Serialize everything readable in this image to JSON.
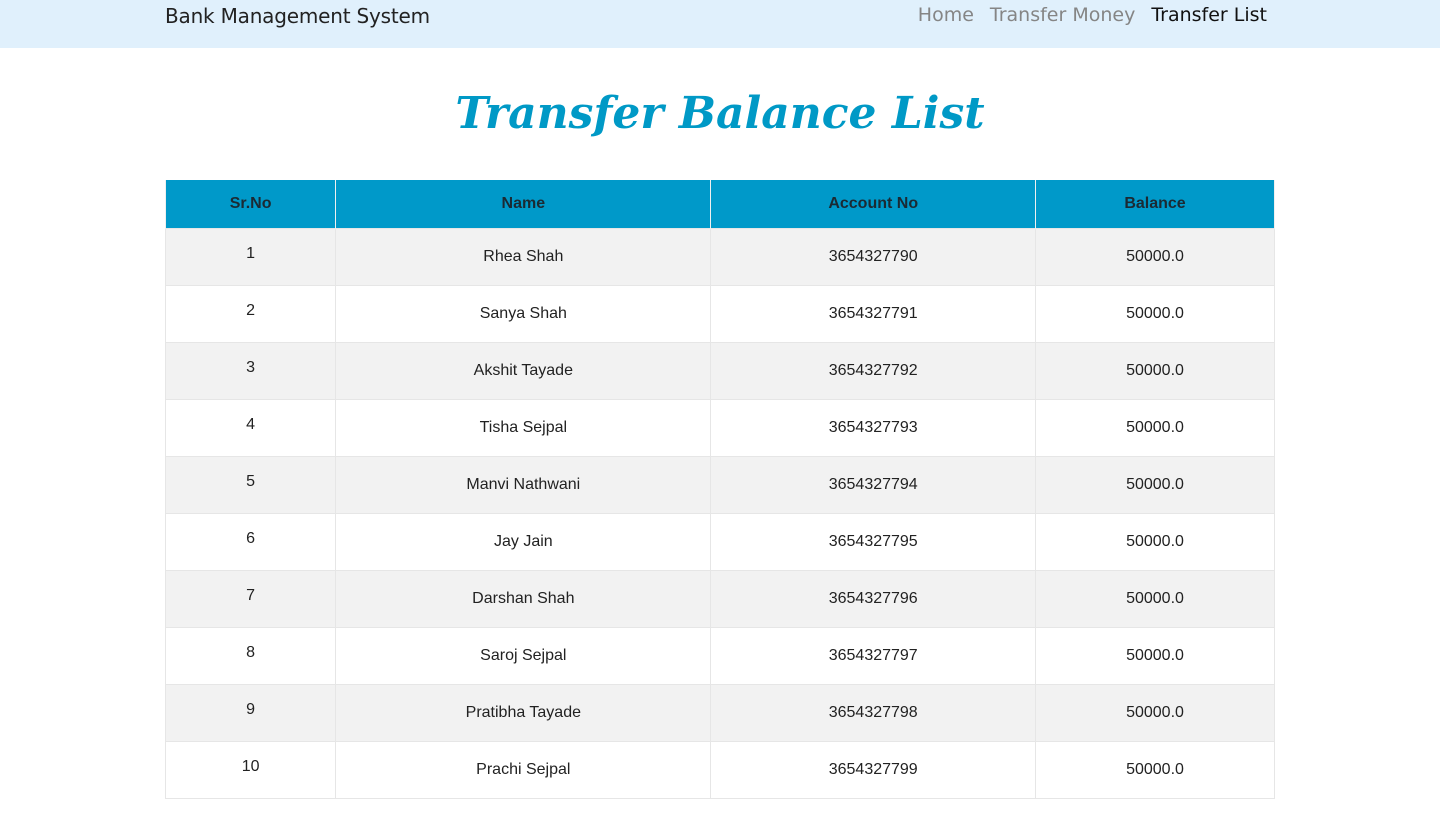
{
  "navbar": {
    "brand": "Bank Management System",
    "links": [
      {
        "label": "Home"
      },
      {
        "label": "Transfer Money"
      },
      {
        "label": "Transfer List"
      }
    ]
  },
  "page": {
    "title": "Transfer Balance List"
  },
  "table": {
    "headers": [
      "Sr.No",
      "Name",
      "Account No",
      "Balance"
    ],
    "rows": [
      {
        "sr": "1",
        "name": "Rhea Shah",
        "account": "3654327790",
        "balance": "50000.0"
      },
      {
        "sr": "2",
        "name": "Sanya Shah",
        "account": "3654327791",
        "balance": "50000.0"
      },
      {
        "sr": "3",
        "name": "Akshit Tayade",
        "account": "3654327792",
        "balance": "50000.0"
      },
      {
        "sr": "4",
        "name": "Tisha Sejpal",
        "account": "3654327793",
        "balance": "50000.0"
      },
      {
        "sr": "5",
        "name": "Manvi Nathwani",
        "account": "3654327794",
        "balance": "50000.0"
      },
      {
        "sr": "6",
        "name": "Jay Jain",
        "account": "3654327795",
        "balance": "50000.0"
      },
      {
        "sr": "7",
        "name": "Darshan Shah",
        "account": "3654327796",
        "balance": "50000.0"
      },
      {
        "sr": "8",
        "name": "Saroj Sejpal",
        "account": "3654327797",
        "balance": "50000.0"
      },
      {
        "sr": "9",
        "name": "Pratibha Tayade",
        "account": "3654327798",
        "balance": "50000.0"
      },
      {
        "sr": "10",
        "name": "Prachi Sejpal",
        "account": "3654327799",
        "balance": "50000.0"
      }
    ]
  },
  "colors": {
    "navbar_bg": "#e0f0fc",
    "accent": "#0099c6",
    "row_stripe": "#f2f2f2"
  }
}
